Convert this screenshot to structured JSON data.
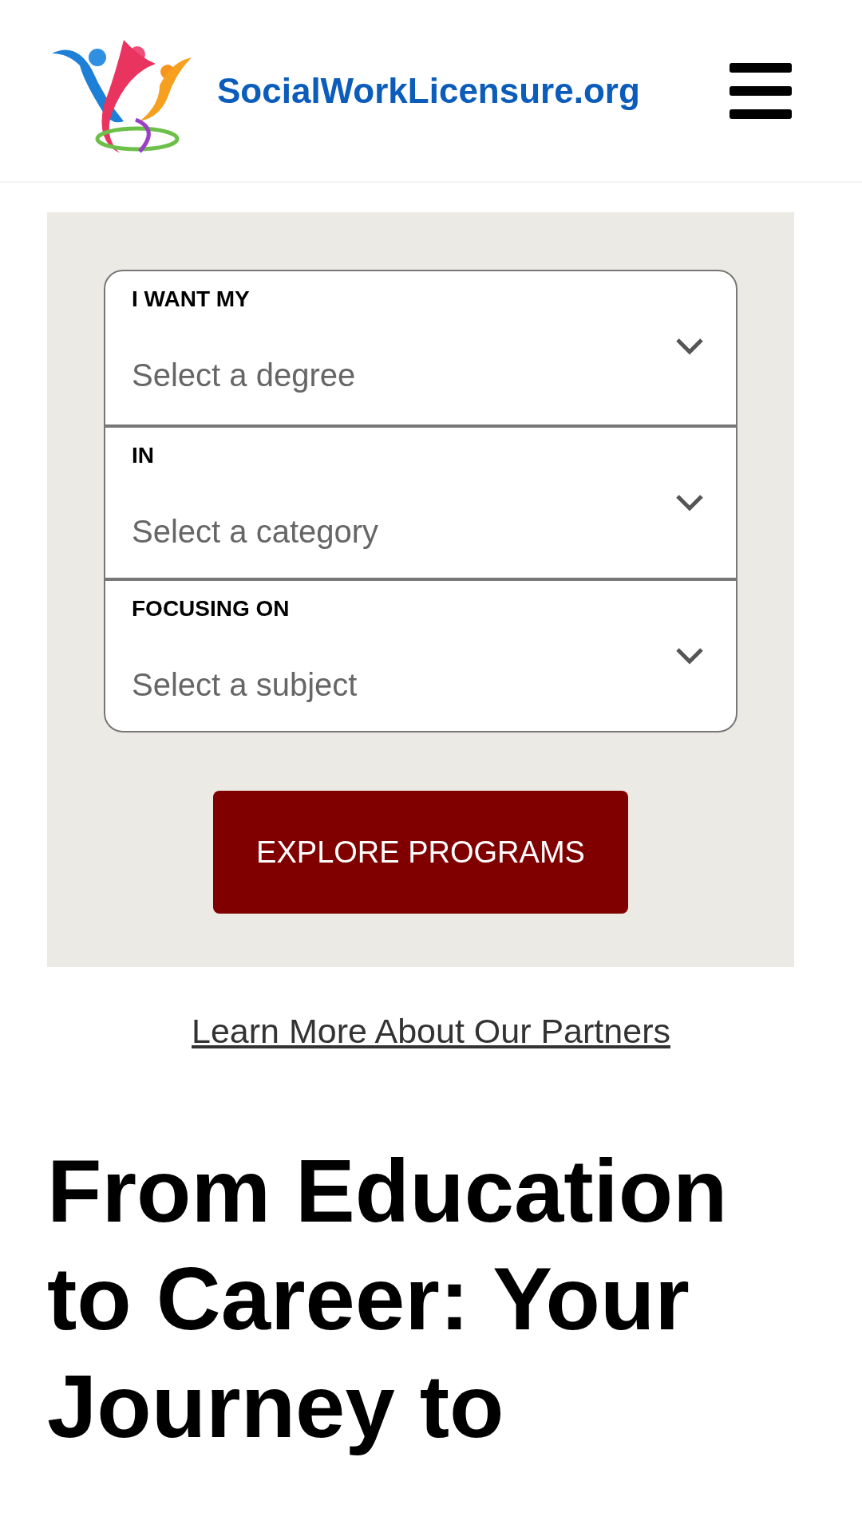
{
  "header": {
    "site_name": "SocialWorkLicensure.org"
  },
  "search_form": {
    "fields": [
      {
        "label": "I WANT MY",
        "placeholder": "Select a degree"
      },
      {
        "label": "IN",
        "placeholder": "Select a category"
      },
      {
        "label": "FOCUSING ON",
        "placeholder": "Select a subject"
      }
    ],
    "button": "EXPLORE PROGRAMS"
  },
  "partners_link": "Learn More About Our Partners",
  "heading": "From Education to Career: Your Journey to"
}
